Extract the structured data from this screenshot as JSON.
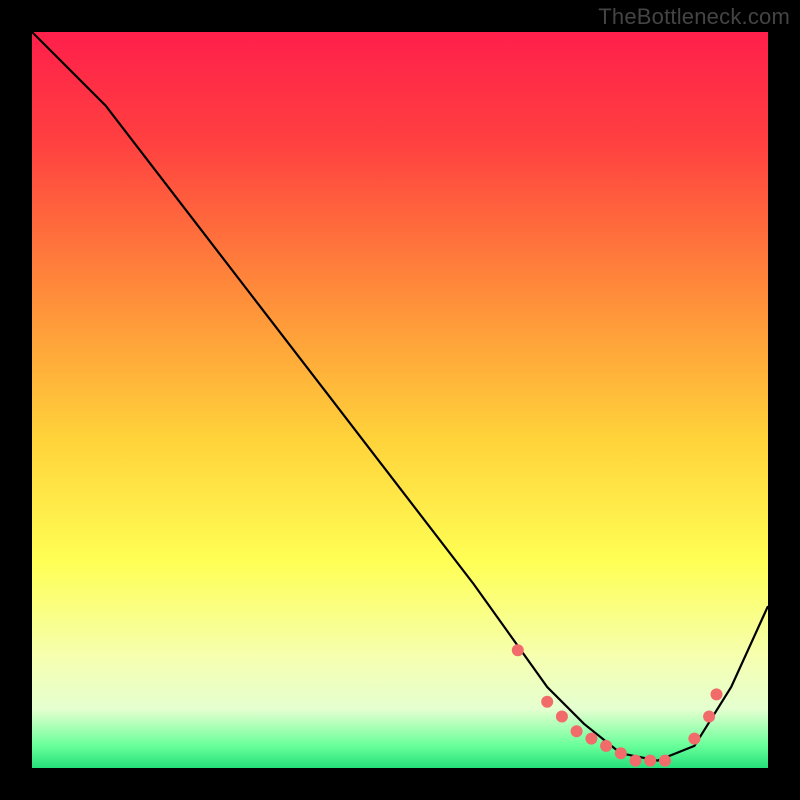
{
  "watermark": "TheBottleneck.com",
  "chart_data": {
    "type": "line",
    "title": "",
    "xlabel": "",
    "ylabel": "",
    "xlim": [
      0,
      100
    ],
    "ylim": [
      0,
      100
    ],
    "grid": false,
    "series": [
      {
        "name": "curve",
        "x": [
          0,
          6,
          10,
          20,
          30,
          40,
          50,
          60,
          65,
          70,
          75,
          80,
          85,
          90,
          95,
          100
        ],
        "y": [
          100,
          94,
          90,
          77,
          64,
          51,
          38,
          25,
          18,
          11,
          6,
          2,
          1,
          3,
          11,
          22
        ],
        "color": "#000000"
      }
    ],
    "markers": {
      "name": "sweet-spot",
      "x": [
        66,
        70,
        72,
        74,
        76,
        78,
        80,
        82,
        84,
        86,
        90,
        92,
        93
      ],
      "y": [
        16,
        9,
        7,
        5,
        4,
        3,
        2,
        1,
        1,
        1,
        4,
        7,
        10
      ],
      "color": "#f26b6b"
    },
    "gradient_stops": [
      {
        "offset": 0.0,
        "color": "#ff1f4b"
      },
      {
        "offset": 0.15,
        "color": "#ff4040"
      },
      {
        "offset": 0.35,
        "color": "#ff8a3a"
      },
      {
        "offset": 0.55,
        "color": "#ffd23a"
      },
      {
        "offset": 0.72,
        "color": "#ffff55"
      },
      {
        "offset": 0.85,
        "color": "#f5ffb0"
      },
      {
        "offset": 0.92,
        "color": "#e5ffd0"
      },
      {
        "offset": 0.97,
        "color": "#68ff9a"
      },
      {
        "offset": 1.0,
        "color": "#24e07a"
      }
    ]
  }
}
